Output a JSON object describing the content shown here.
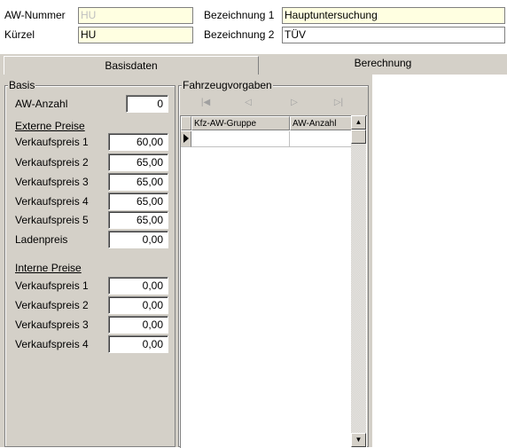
{
  "header": {
    "aw_nummer_label": "AW-Nummer",
    "aw_nummer_value": "HU",
    "kuerzel_label": "Kürzel",
    "kuerzel_value": "HU",
    "bezeichnung1_label": "Bezeichnung 1",
    "bezeichnung1_value": "Hauptuntersuchung",
    "bezeichnung2_label": "Bezeichnung 2",
    "bezeichnung2_value": "TÜV"
  },
  "tabs": [
    {
      "label": "Basisdaten"
    },
    {
      "label": "Berechnung"
    }
  ],
  "basis": {
    "legend": "Basis",
    "aw_anzahl_label": "AW-Anzahl",
    "aw_anzahl_value": "0",
    "externe_heading": "Externe Preise",
    "externe": [
      {
        "label": "Verkaufspreis 1",
        "value": "60,00"
      },
      {
        "label": "Verkaufspreis 2",
        "value": "65,00"
      },
      {
        "label": "Verkaufspreis 3",
        "value": "65,00"
      },
      {
        "label": "Verkaufspreis 4",
        "value": "65,00"
      },
      {
        "label": "Verkaufspreis 5",
        "value": "65,00"
      },
      {
        "label": "Ladenpreis",
        "value": "0,00"
      }
    ],
    "interne_heading": "Interne Preise",
    "interne": [
      {
        "label": "Verkaufspreis 1",
        "value": "0,00"
      },
      {
        "label": "Verkaufspreis 2",
        "value": "0,00"
      },
      {
        "label": "Verkaufspreis 3",
        "value": "0,00"
      },
      {
        "label": "Verkaufspreis 4",
        "value": "0,00"
      }
    ]
  },
  "fahrzeug": {
    "legend": "Fahrzeugvorgaben",
    "nav": [
      "first-icon",
      "prev-icon",
      "next-icon",
      "last-icon"
    ],
    "columns": [
      "Kfz-AW-Gruppe",
      "AW-Anzahl"
    ]
  },
  "colors": {
    "panel": "#d4d0c8",
    "readonly_field": "#ffffe1"
  }
}
